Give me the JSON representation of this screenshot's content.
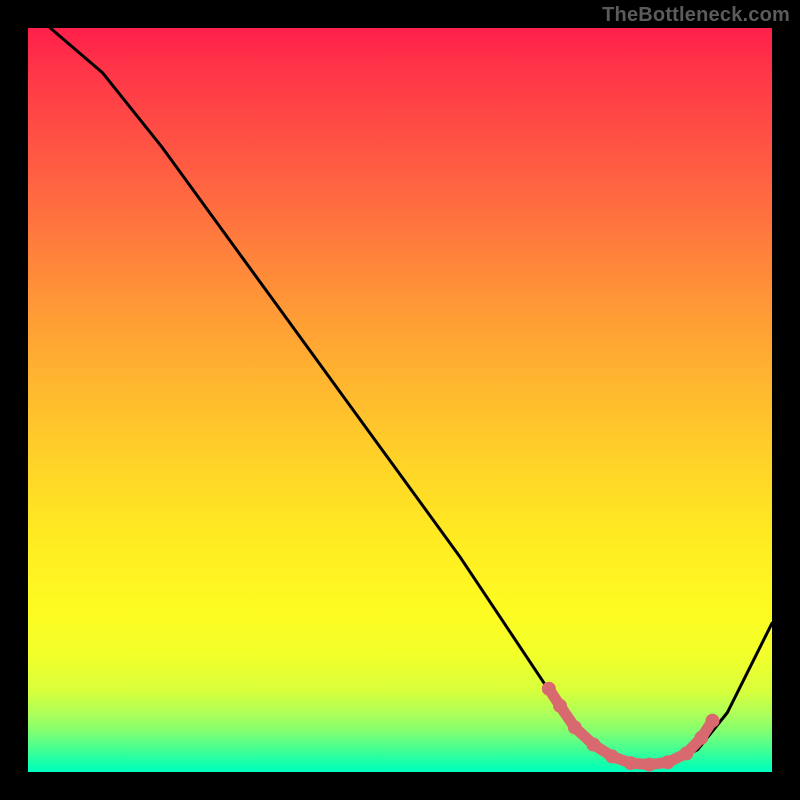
{
  "watermark": "TheBottleneck.com",
  "chart_data": {
    "type": "line",
    "title": "",
    "xlabel": "",
    "ylabel": "",
    "xlim": [
      0,
      100
    ],
    "ylim": [
      0,
      100
    ],
    "note": "No axis ticks, labels, or numeric values are shown in the source image; the curve and marker positions below are estimated from pixel geometry as fractions of the plot area (0–100).",
    "series": [
      {
        "name": "bottleneck-curve",
        "type": "line",
        "x": [
          3,
          10,
          18,
          26,
          34,
          42,
          50,
          58,
          64,
          70,
          74,
          78,
          82,
          86,
          90,
          94,
          100
        ],
        "y": [
          100,
          94,
          84,
          73,
          62,
          51,
          40,
          29,
          20,
          11,
          5,
          2,
          1,
          1,
          3,
          8,
          20
        ],
        "color": "#000000"
      },
      {
        "name": "optimal-range-markers",
        "type": "scatter",
        "x": [
          70.0,
          71.5,
          73.5,
          76.0,
          78.5,
          81.0,
          83.5,
          86.0,
          88.5,
          90.5,
          92.0
        ],
        "y": [
          11.2,
          8.9,
          6.0,
          3.7,
          2.1,
          1.2,
          1.0,
          1.3,
          2.5,
          4.6,
          6.9
        ],
        "color": "#d86a6f"
      }
    ]
  },
  "colors": {
    "background": "#000000",
    "watermark": "#5b5b5b",
    "curve": "#000000",
    "markers": "#d86a6f"
  }
}
